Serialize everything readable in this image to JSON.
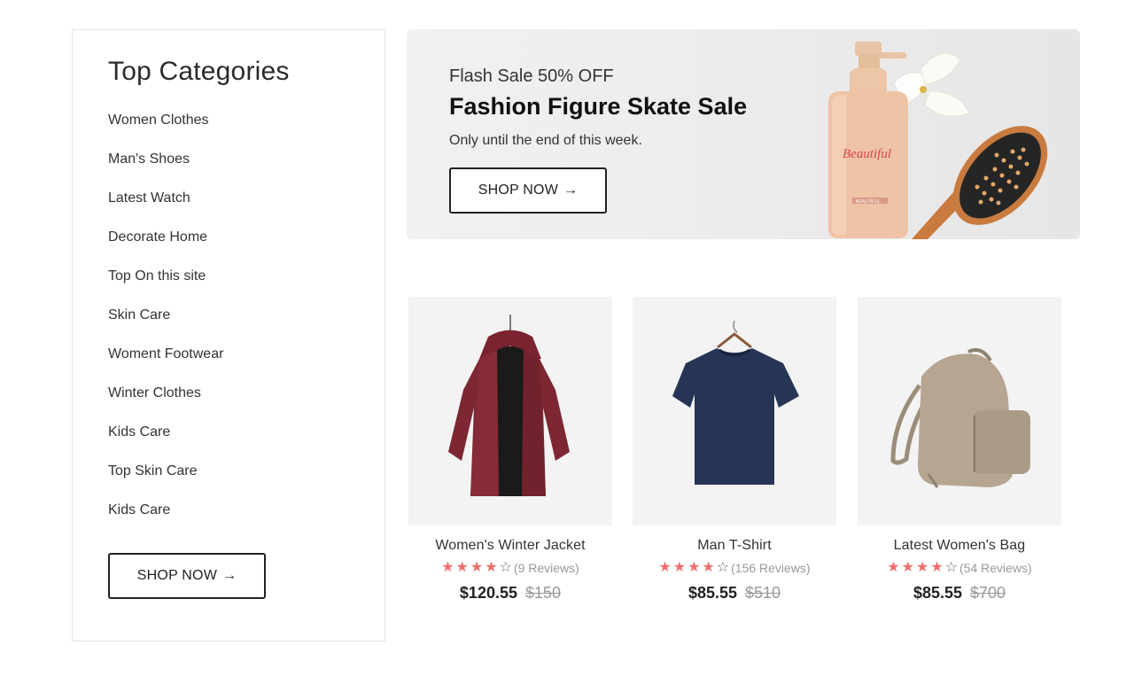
{
  "sidebar": {
    "title": "Top Categories",
    "categories": [
      "Women Clothes",
      "Man's Shoes",
      "Latest Watch",
      "Decorate Home",
      "Top On this site",
      "Skin Care",
      "Woment Footwear",
      "Winter Clothes",
      "Kids Care",
      "Top Skin Care",
      "Kids Care"
    ],
    "button_label": "SHOP NOW",
    "button_icon": "arrow-right-icon"
  },
  "banner": {
    "kicker": "Flash Sale 50% OFF",
    "title": "Fashion Figure Skate Sale",
    "subtitle": "Only until the end of this week.",
    "button_label": "SHOP NOW",
    "button_icon": "arrow-right-icon",
    "bottle_label": "Beautiful",
    "bottle_tag": "BEAUTIFUL"
  },
  "products": [
    {
      "name": "Women's Winter Jacket",
      "rating": 4,
      "max_rating": 5,
      "reviews": "(9 Reviews)",
      "price": "$120.55",
      "old_price": "$150",
      "image": "jacket-image"
    },
    {
      "name": "Man T-Shirt",
      "rating": 4,
      "max_rating": 5,
      "reviews": "(156 Reviews)",
      "price": "$85.55",
      "old_price": "$510",
      "image": "tshirt-image"
    },
    {
      "name": "Latest Women's Bag",
      "rating": 4,
      "max_rating": 5,
      "reviews": "(54 Reviews)",
      "price": "$85.55",
      "old_price": "$700",
      "image": "backpack-image"
    }
  ],
  "colors": {
    "star_filled": "#f26c6c",
    "star_empty": "#666666",
    "image_bg": "#f3f3f3"
  }
}
